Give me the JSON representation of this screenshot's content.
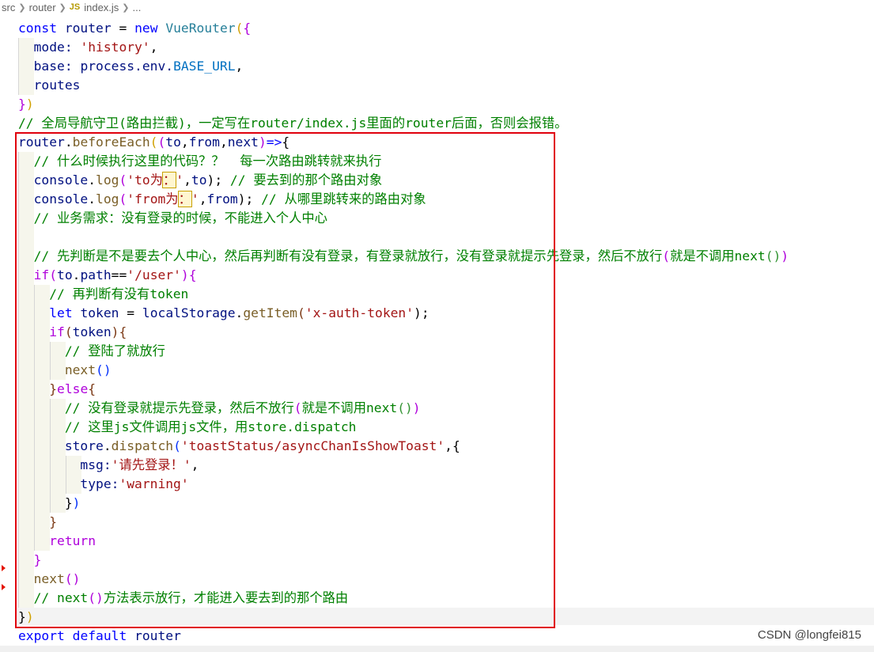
{
  "breadcrumb": {
    "items": [
      "src",
      "router",
      "index.js",
      "..."
    ],
    "file_badge": "JS"
  },
  "watermark": "CSDN @longfei815",
  "code": {
    "l1": [
      "const",
      "router",
      "=",
      "new",
      "VueRouter",
      "(",
      "{"
    ],
    "l2": [
      "mode:",
      "'history'",
      ","
    ],
    "l3": [
      "base:",
      "process.env.",
      "BASE_URL",
      ","
    ],
    "l4": [
      "routes"
    ],
    "l5": [
      "}",
      ")"
    ],
    "l6": "// 全局导航守卫(路由拦截)，一定写在router/index.js里面的router后面，否则会报错。",
    "l7": [
      "router",
      ".",
      "beforeEach",
      "(",
      "(",
      "to",
      ",",
      "from",
      ",",
      "next",
      ")",
      "=>",
      "{"
    ],
    "l8": "// 什么时候执行这里的代码？？  每一次路由跳转就来执行",
    "l9": [
      "console",
      ".",
      "log",
      "(",
      "'to为",
      "：",
      "'",
      ",",
      "to",
      ");",
      " // 要去到的那个路由对象"
    ],
    "l10": [
      "console",
      ".",
      "log",
      "(",
      "'from为",
      "：",
      "'",
      ",",
      "from",
      ");",
      " // 从哪里跳转来的路由对象"
    ],
    "l11": "// 业务需求：没有登录的时候，不能进入个人中心",
    "l13": [
      "// 先判断是不是要去个人中心，然后再判断有没有登录，有登录就放行，没有登录就提示先登录，然后不放行",
      "(",
      "就是不调用next",
      "()",
      ")"
    ],
    "l14": [
      "if",
      "(",
      "to",
      ".",
      "path",
      "==",
      "'/user'",
      ")",
      "{"
    ],
    "l15": "// 再判断有没有token",
    "l16": [
      "let",
      "token",
      "=",
      "localStorage",
      ".",
      "getItem",
      "(",
      "'x-auth-token'",
      ");"
    ],
    "l17": [
      "if",
      "(",
      "token",
      ")",
      "{"
    ],
    "l18": "// 登陆了就放行",
    "l19": [
      "next",
      "()"
    ],
    "l20": [
      "}",
      "else",
      "{"
    ],
    "l21": [
      "// 没有登录就提示先登录，然后不放行",
      "(",
      "就是不调用next",
      "()",
      ")"
    ],
    "l22": "// 这里js文件调用js文件，用store.dispatch",
    "l23": [
      "store",
      ".",
      "dispatch",
      "(",
      "'toastStatus/asyncChanIsShowToast'",
      ",",
      "{"
    ],
    "l24": [
      "msg:",
      "'请先登录！'",
      ","
    ],
    "l25": [
      "type:",
      "'warning'"
    ],
    "l26": [
      "}",
      ")"
    ],
    "l27": [
      "}"
    ],
    "l28": [
      "return"
    ],
    "l29": [
      "}"
    ],
    "l30": [
      "next",
      "()"
    ],
    "l31": [
      "// next",
      "()",
      "方法表示放行，才能进入要去到的那个路由"
    ],
    "l32": [
      "}",
      ")"
    ],
    "l33": [
      "export",
      "default",
      "router"
    ]
  },
  "colors": {
    "selection_box": "#e0000d",
    "keyword": "#0000ff",
    "control": "#af00db",
    "variable": "#001080",
    "function": "#795e26",
    "class": "#267f99",
    "string": "#a31515",
    "comment": "#008000",
    "constant": "#0070c1"
  }
}
